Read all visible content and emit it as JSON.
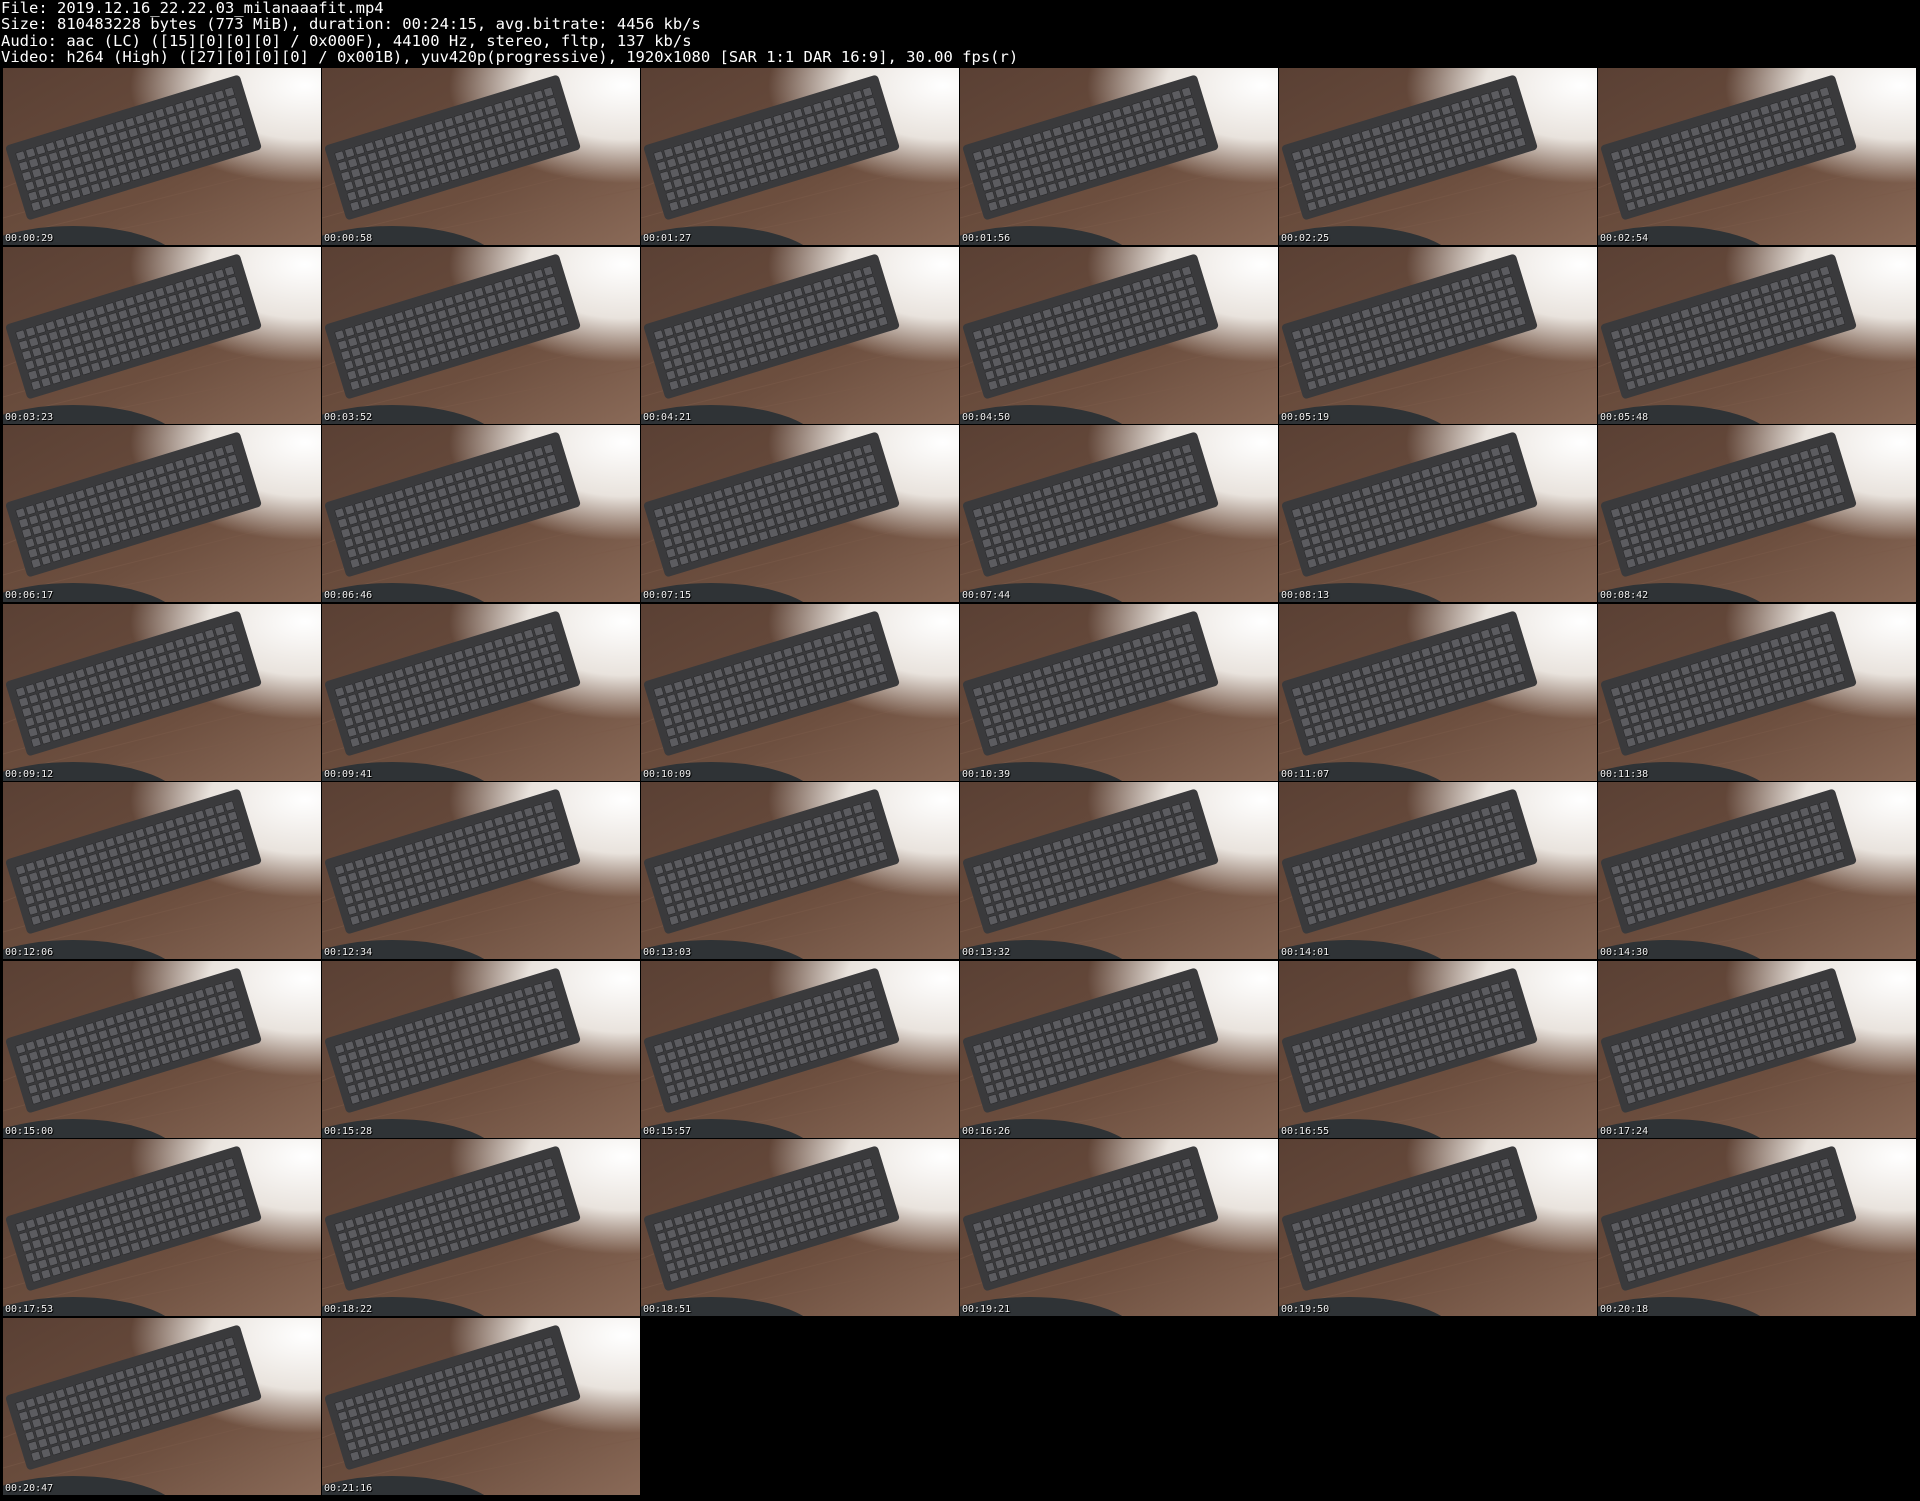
{
  "header": {
    "file_line": "File: 2019.12.16_22.22.03_milanaaafit.mp4",
    "size_line": "Size: 810483228 bytes (773 MiB), duration: 00:24:15, avg.bitrate: 4456 kb/s",
    "audio_line": "Audio: aac (LC) ([15][0][0][0] / 0x000F), 44100 Hz, stereo, fltp, 137 kb/s",
    "video_line": "Video: h264 (High) ([27][0][0][0] / 0x001B), yuv420p(progressive), 1920x1080 [SAR 1:1 DAR 16:9], 30.00 fps(r)"
  },
  "thumbnails": [
    {
      "timestamp": "00:00:29",
      "subject": "keyboard-on-wooden-desk"
    },
    {
      "timestamp": "00:00:58",
      "subject": "keyboard-on-wooden-desk"
    },
    {
      "timestamp": "00:01:27",
      "subject": "keyboard-on-wooden-desk"
    },
    {
      "timestamp": "00:01:56",
      "subject": "keyboard-on-wooden-desk"
    },
    {
      "timestamp": "00:02:25",
      "subject": "keyboard-on-wooden-desk"
    },
    {
      "timestamp": "00:02:54",
      "subject": "keyboard-on-wooden-desk"
    },
    {
      "timestamp": "00:03:23",
      "subject": "keyboard-on-wooden-desk"
    },
    {
      "timestamp": "00:03:52",
      "subject": "keyboard-on-wooden-desk"
    },
    {
      "timestamp": "00:04:21",
      "subject": "keyboard-on-wooden-desk"
    },
    {
      "timestamp": "00:04:50",
      "subject": "keyboard-on-wooden-desk"
    },
    {
      "timestamp": "00:05:19",
      "subject": "keyboard-on-wooden-desk"
    },
    {
      "timestamp": "00:05:48",
      "subject": "keyboard-on-wooden-desk"
    },
    {
      "timestamp": "00:06:17",
      "subject": "keyboard-on-wooden-desk"
    },
    {
      "timestamp": "00:06:46",
      "subject": "keyboard-on-wooden-desk"
    },
    {
      "timestamp": "00:07:15",
      "subject": "keyboard-on-wooden-desk"
    },
    {
      "timestamp": "00:07:44",
      "subject": "keyboard-on-wooden-desk"
    },
    {
      "timestamp": "00:08:13",
      "subject": "keyboard-on-wooden-desk"
    },
    {
      "timestamp": "00:08:42",
      "subject": "keyboard-on-wooden-desk"
    },
    {
      "timestamp": "00:09:12",
      "subject": "keyboard-on-wooden-desk"
    },
    {
      "timestamp": "00:09:41",
      "subject": "keyboard-on-wooden-desk"
    },
    {
      "timestamp": "00:10:09",
      "subject": "keyboard-on-wooden-desk"
    },
    {
      "timestamp": "00:10:39",
      "subject": "keyboard-on-wooden-desk"
    },
    {
      "timestamp": "00:11:07",
      "subject": "keyboard-on-wooden-desk"
    },
    {
      "timestamp": "00:11:38",
      "subject": "keyboard-on-wooden-desk"
    },
    {
      "timestamp": "00:12:06",
      "subject": "keyboard-on-wooden-desk"
    },
    {
      "timestamp": "00:12:34",
      "subject": "keyboard-on-wooden-desk"
    },
    {
      "timestamp": "00:13:03",
      "subject": "keyboard-on-wooden-desk"
    },
    {
      "timestamp": "00:13:32",
      "subject": "keyboard-on-wooden-desk"
    },
    {
      "timestamp": "00:14:01",
      "subject": "keyboard-on-wooden-desk"
    },
    {
      "timestamp": "00:14:30",
      "subject": "keyboard-on-wooden-desk"
    },
    {
      "timestamp": "00:15:00",
      "subject": "keyboard-on-wooden-desk"
    },
    {
      "timestamp": "00:15:28",
      "subject": "keyboard-on-wooden-desk"
    },
    {
      "timestamp": "00:15:57",
      "subject": "keyboard-on-wooden-desk"
    },
    {
      "timestamp": "00:16:26",
      "subject": "keyboard-on-wooden-desk"
    },
    {
      "timestamp": "00:16:55",
      "subject": "keyboard-on-wooden-desk"
    },
    {
      "timestamp": "00:17:24",
      "subject": "keyboard-on-wooden-desk"
    },
    {
      "timestamp": "00:17:53",
      "subject": "keyboard-on-wooden-desk"
    },
    {
      "timestamp": "00:18:22",
      "subject": "keyboard-on-wooden-desk"
    },
    {
      "timestamp": "00:18:51",
      "subject": "keyboard-on-wooden-desk"
    },
    {
      "timestamp": "00:19:21",
      "subject": "keyboard-on-wooden-desk"
    },
    {
      "timestamp": "00:19:50",
      "subject": "keyboard-on-wooden-desk"
    },
    {
      "timestamp": "00:20:18",
      "subject": "keyboard-on-wooden-desk"
    },
    {
      "timestamp": "00:20:47",
      "subject": "keyboard-on-wooden-desk"
    },
    {
      "timestamp": "00:21:16",
      "subject": "keyboard-on-wooden-desk"
    }
  ],
  "colors": {
    "background": "#000000",
    "text": "#ffffff",
    "desk_wood": "#6d4f3f",
    "desk_light": "#e9e3dd",
    "keyboard_body": "#3a3a3c",
    "keyboard_key": "#5c5c60",
    "mousepad": "#2f3336"
  }
}
